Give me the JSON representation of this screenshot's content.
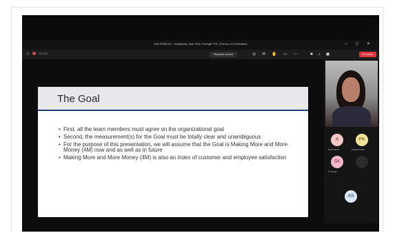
{
  "window": {
    "title": "MIS 8765CAS - Multiplying Cash Flow Through TOC (Theory of Constraints)",
    "controls": "– ◻ ✕"
  },
  "toolbar": {
    "meeting_id": "FNTS5",
    "request_control": "Request control",
    "leave_label": "Leave"
  },
  "slide": {
    "title": "The Goal",
    "bullets": [
      "First, all the team members must agree on the organizational goal",
      "Second, the measurement(s) for the Goal must be totally clear and unambiguous",
      "For the purpose of this presentation, we will assume that the Goal is Making More and More Money (4M) now and as well as in future",
      "Making More and More Money (4M) is also an index of customer and employee satisfaction"
    ]
  },
  "participants": [
    {
      "initials": "A",
      "name": "Amit Kumar",
      "bg": "#f3c7c7",
      "fg": "#8a3a3a"
    },
    {
      "initials": "PK",
      "name": "Pankaj Kumar",
      "bg": "#f2e39a",
      "fg": "#6a5a10"
    },
    {
      "initials": "SK",
      "name": "S. Kumar",
      "bg": "#f1b8c8",
      "fg": "#8a2a4a"
    },
    {
      "initials": "AS",
      "name": "",
      "bg": "#dbe8f7",
      "fg": "#2a4a7a"
    }
  ],
  "colors": {
    "accent_line": "#1f3e7a",
    "leave": "#e0333a"
  }
}
